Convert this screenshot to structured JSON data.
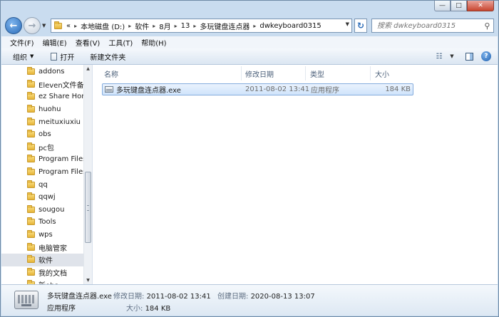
{
  "window": {
    "caption_minimize": "—",
    "caption_maximize": "□",
    "caption_close": "✕"
  },
  "address": {
    "leading": "«",
    "crumbs": [
      "本地磁盘 (D:)",
      "软件",
      "8月",
      "13",
      "多玩键盘连点器",
      "dwkeyboard0315"
    ],
    "separator": "▸",
    "search_placeholder": "搜索 dwkeyboard0315"
  },
  "menu": [
    "文件(F)",
    "编辑(E)",
    "查看(V)",
    "工具(T)",
    "帮助(H)"
  ],
  "toolbar": {
    "organize": "组织",
    "open": "打开",
    "new_folder": "新建文件夹"
  },
  "tree": {
    "items": [
      "addons",
      "Eleven文件备份",
      "ez Share Hom",
      "huohu",
      "meituxiuxiu",
      "obs",
      "pc包",
      "Program Files",
      "Program Files",
      "qq",
      "qqwj",
      "sougou",
      "Tools",
      "wps",
      "电脑管家",
      "软件",
      "我的文档",
      "新obs"
    ],
    "selected_index": 15
  },
  "columns": {
    "name": "名称",
    "modified": "修改日期",
    "type": "类型",
    "size": "大小"
  },
  "files": [
    {
      "name": "多玩键盘连点器.exe",
      "modified": "2011-08-02 13:41",
      "type": "应用程序",
      "size": "184 KB"
    }
  ],
  "details": {
    "name": "多玩键盘连点器.exe",
    "modified_label": "修改日期:",
    "modified": "2011-08-02 13:41",
    "created_label": "创建日期:",
    "created": "2020-08-13 13:07",
    "type": "应用程序",
    "size_label": "大小:",
    "size": "184 KB"
  }
}
